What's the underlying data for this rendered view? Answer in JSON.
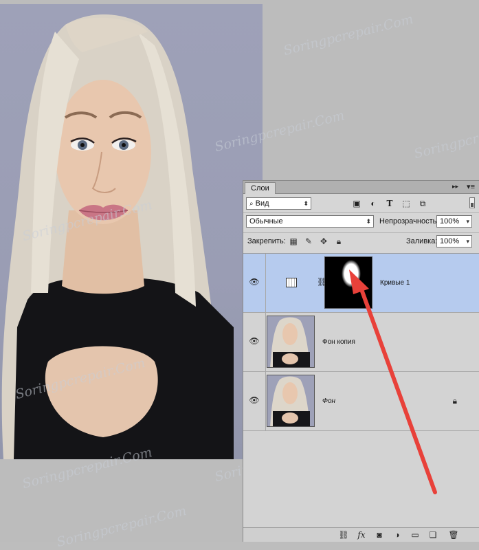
{
  "watermark_text": "Soringpcrepair.Com",
  "panel": {
    "tab_label": "Слои",
    "collapse_glyph": "▸▸",
    "menu_glyph": "▾≡"
  },
  "filter": {
    "kind_value": "Вид",
    "kind_icon": "search-icon",
    "icons": [
      "pixel-filter-icon",
      "adjustment-filter-icon",
      "type-filter-icon",
      "shape-filter-icon",
      "smart-object-filter-icon"
    ]
  },
  "blend": {
    "mode": "Обычные",
    "opacity_label": "Непрозрачность:",
    "opacity_value": "100%"
  },
  "lock": {
    "label": "Закрепить:",
    "fill_label": "Заливка:",
    "fill_value": "100%"
  },
  "layers": [
    {
      "name": "Кривые 1",
      "type": "adjustment",
      "selected": true,
      "visible": true
    },
    {
      "name": "Фон копия",
      "type": "pixel",
      "selected": false,
      "visible": true
    },
    {
      "name": "Фон",
      "type": "background",
      "selected": false,
      "visible": true,
      "locked": true
    }
  ],
  "bottom_icons": [
    "link-layers-icon",
    "fx-icon",
    "add-mask-icon",
    "new-adjustment-icon",
    "new-group-icon",
    "new-layer-icon",
    "delete-icon"
  ],
  "fx_label": "fx",
  "colors": {
    "selected_row": "#b6cbee",
    "arrow": "#e8413a",
    "background_photo": "#9ea1b8"
  }
}
